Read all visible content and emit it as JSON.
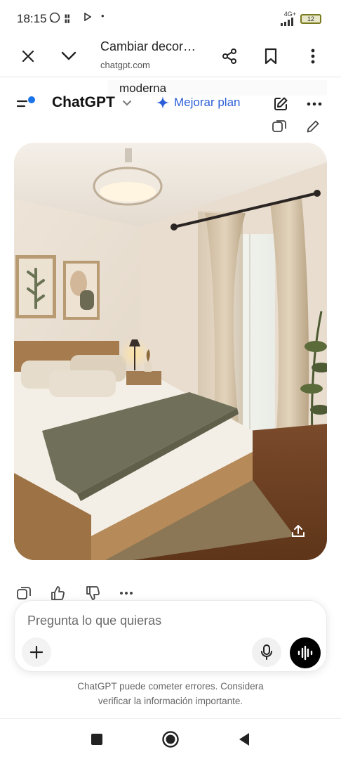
{
  "status_bar": {
    "time": "18:15",
    "network": "4G+",
    "battery": "12"
  },
  "browser": {
    "title": "Cambiar decor…",
    "url": "chatgpt.com"
  },
  "chat": {
    "tooltip_fragment": "moderna",
    "brand": "ChatGPT",
    "upgrade_label": "Mejorar plan",
    "accent_color": "#2b5fd9"
  },
  "composer": {
    "placeholder": "Pregunta lo que quieras"
  },
  "disclaimer": {
    "line1": "ChatGPT puede cometer errores. Considera",
    "line2": "verificar la información importante."
  },
  "icons": {
    "close": "close-icon",
    "collapse": "chevron-down-icon",
    "share": "share-icon",
    "bookmark": "bookmark-icon",
    "more": "more-vertical-icon",
    "sidebar": "sidebar-menu-icon",
    "new_chat": "edit-icon",
    "options": "more-horizontal-icon",
    "copy": "copy-icon",
    "like": "thumbs-up-icon",
    "dislike": "thumbs-down-icon",
    "plus": "plus-icon",
    "mic": "microphone-icon",
    "voice": "voice-mode-icon"
  }
}
